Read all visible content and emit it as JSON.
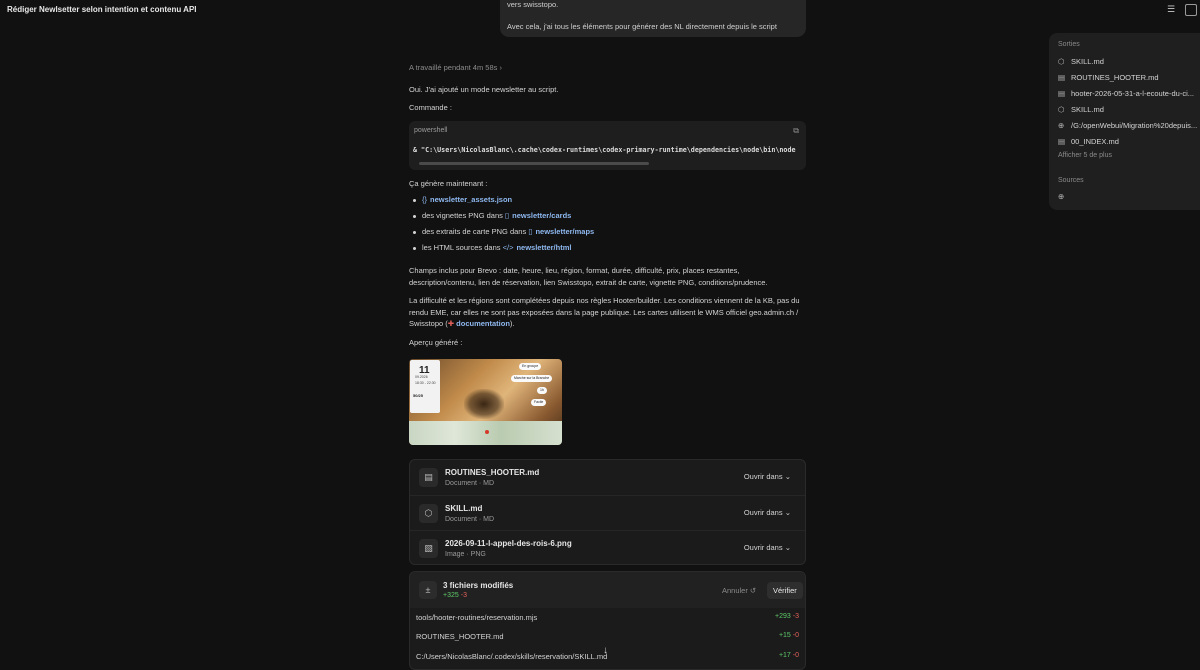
{
  "header": {
    "title": "Rédiger Newlsetter selon intention et contenu API",
    "more": "···"
  },
  "previous_message": {
    "line1": "vers swisstopo.",
    "line2": "Avec cela, j'ai tous les éléments pour générer des NL directement depuis le script"
  },
  "reply": {
    "worked": "A travaillé pendant 4m 58s",
    "intro": "Oui. J'ai ajouté un mode newsletter au script.",
    "command_label": "Commande :",
    "code": {
      "lang": "powershell",
      "line": "& \"C:\\Users\\NicolasBlanc\\.cache\\codex-runtimes\\codex-primary-runtime\\dependencies\\node\\bin\\node"
    },
    "generates": "Ça génère maintenant :",
    "bullets": [
      {
        "prefix": "",
        "link": "newsletter_assets.json",
        "icon": "{}"
      },
      {
        "prefix": "des vignettes PNG dans",
        "link": "newsletter/cards",
        "icon": "▯"
      },
      {
        "prefix": "des extraits de carte PNG dans",
        "link": "newsletter/maps",
        "icon": "▯"
      },
      {
        "prefix": "les HTML sources dans",
        "link": "newsletter/html",
        "icon": "</>"
      }
    ],
    "fields_1": "Champs inclus pour Brevo : date, heure, lieu, région, format, durée, difficulté, prix, places restantes,",
    "fields_2": "description/contenu, lien de réservation, lien Swisstopo, extrait de carte, vignette PNG, conditions/prudence.",
    "difficulty_1": "La difficulté et les régions sont complétées depuis nos règles Hooter/builder. Les conditions viennent de la KB, pas du",
    "difficulty_2": "rendu EME, car elles ne sont pas exposées dans la page publique. Les cartes utilisent le WMS officiel geo.admin.ch /",
    "difficulty_3_prefix": "Swisstopo (",
    "difficulty_3_flag": "✚",
    "difficulty_3_link": "documentation",
    "difficulty_3_suffix": ").",
    "preview_label": "Aperçu généré :",
    "preview_card": {
      "day": "11",
      "date": "09.2026",
      "time": "18:30 - 22:30",
      "places": "50/25",
      "pills": [
        "En groupe",
        "Marche sur la Branche",
        "1h",
        "Facile"
      ]
    }
  },
  "files": [
    {
      "name": "ROUTINES_HOOTER.md",
      "meta": "Document · MD",
      "icon": "doc-icon",
      "glyph": "▤",
      "open": "Ouvrir dans"
    },
    {
      "name": "SKILL.md",
      "meta": "Document · MD",
      "icon": "cube-icon",
      "glyph": "⬡",
      "open": "Ouvrir dans"
    },
    {
      "name": "2026-09-11-l-appel-des-rois-6.png",
      "meta": "Image · PNG",
      "icon": "image-icon",
      "glyph": "▧",
      "open": "Ouvrir dans"
    }
  ],
  "changes": {
    "title": "3 fichiers modifiés",
    "plus": "+325",
    "minus": "-3",
    "undo": "Annuler ↺",
    "verify": "Vérifier",
    "rows": [
      {
        "path": "tools/hooter-routines/reservation.mjs",
        "plus": "+293",
        "minus": "-3"
      },
      {
        "path": "ROUTINES_HOOTER.md",
        "plus": "+15",
        "minus": "-0"
      },
      {
        "path": "C:/Users/NicolasBlanc/.codex/skills/reservation/SKILL.md",
        "plus": "+17",
        "minus": "-0"
      }
    ]
  },
  "sidebar": {
    "outputs_label": "Sorties",
    "outputs": [
      {
        "label": "SKILL.md",
        "glyph": "⬡"
      },
      {
        "label": "ROUTINES_HOOTER.md",
        "glyph": "▤"
      },
      {
        "label": "hooter-2026-05-31-a-l-ecoute-du-ci...",
        "glyph": "▤"
      },
      {
        "label": "SKILL.md",
        "glyph": "⬡"
      },
      {
        "label": "/G:/openWebui/Migration%20depuis...",
        "glyph": "⊕"
      },
      {
        "label": "00_INDEX.md",
        "glyph": "▤"
      }
    ],
    "more": "Afficher 5 de plus",
    "sources_label": "Sources",
    "sources_glyph": "⊕"
  },
  "colors": {
    "background": "#111111",
    "link": "#8fb8ef",
    "added": "#5fc96a",
    "removed": "#e0605a"
  }
}
